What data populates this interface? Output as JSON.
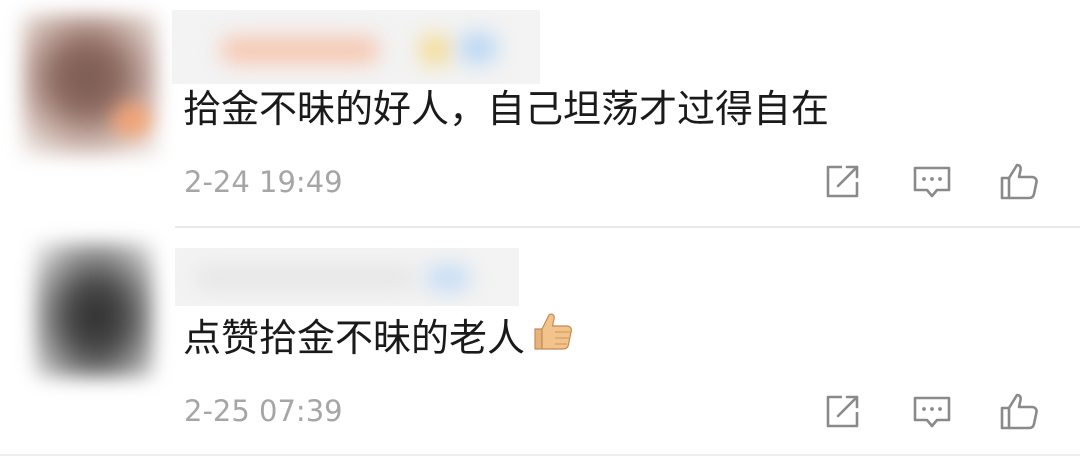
{
  "comments": [
    {
      "text": "拾金不昧的好人，自己坦荡才过得自在",
      "timestamp": "2-24 19:49",
      "has_emoji": false
    },
    {
      "text": "点赞拾金不昧的老人",
      "emoji": "thumbs-up",
      "timestamp": "2-25 07:39",
      "has_emoji": true
    }
  ],
  "actions": {
    "share_icon": "share-icon",
    "reply_icon": "comment-icon",
    "like_icon": "thumbs-up-icon"
  },
  "colors": {
    "text": "#1a1a1a",
    "timestamp": "#a6a6a6",
    "icon": "#8a8a8a",
    "divider": "#e8e8e8",
    "emoji_skin": "#f2c48c"
  }
}
